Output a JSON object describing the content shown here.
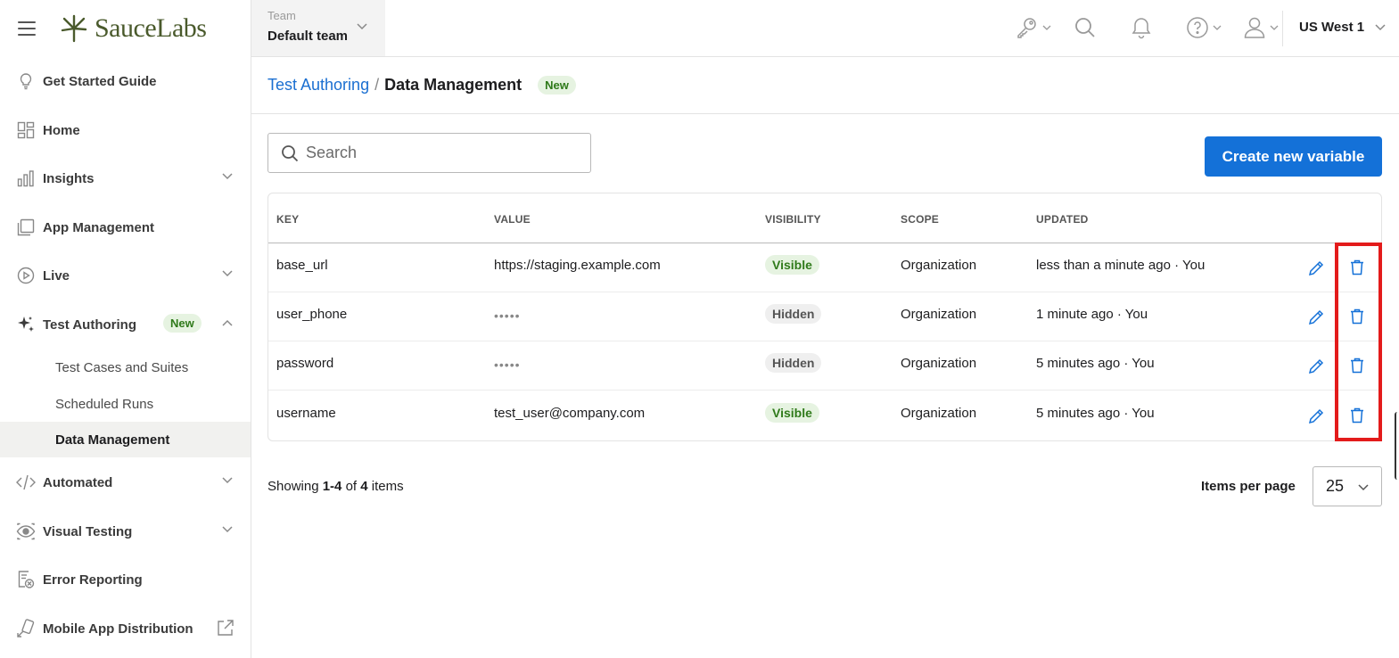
{
  "brand": {
    "name": "SauceLabs"
  },
  "topbar": {
    "team_label": "Team",
    "team_value": "Default team",
    "region": "US West 1"
  },
  "sidebar": {
    "items": [
      {
        "label": "Get Started Guide",
        "icon": "lightbulb-icon"
      },
      {
        "label": "Home",
        "icon": "dashboard-icon"
      },
      {
        "label": "Insights",
        "icon": "bar-chart-icon"
      },
      {
        "label": "App Management",
        "icon": "app-icon"
      },
      {
        "label": "Live",
        "icon": "play-icon"
      },
      {
        "label": "Test Authoring",
        "icon": "sparkle-icon",
        "badge": "New"
      },
      {
        "label": "Automated",
        "icon": "code-icon"
      },
      {
        "label": "Visual Testing",
        "icon": "eye-icon"
      },
      {
        "label": "Error Reporting",
        "icon": "error-report-icon"
      },
      {
        "label": "Mobile App Distribution",
        "icon": "mobile-distribution-icon"
      }
    ],
    "sub_items": [
      {
        "label": "Test Cases and Suites"
      },
      {
        "label": "Scheduled Runs"
      },
      {
        "label": "Data Management"
      }
    ]
  },
  "breadcrumb": {
    "parent": "Test Authoring",
    "separator": "/",
    "current": "Data Management",
    "badge": "New"
  },
  "search": {
    "placeholder": "Search"
  },
  "create_button": "Create new variable",
  "table": {
    "columns": [
      "KEY",
      "VALUE",
      "VISIBILITY",
      "SCOPE",
      "UPDATED"
    ],
    "rows": [
      {
        "key": "base_url",
        "value": "https://staging.example.com",
        "visibility": "Visible",
        "scope": "Organization",
        "updated": "less than a minute ago · You"
      },
      {
        "key": "user_phone",
        "value": "•••••",
        "visibility": "Hidden",
        "scope": "Organization",
        "updated": "1 minute ago · You"
      },
      {
        "key": "password",
        "value": "•••••",
        "visibility": "Hidden",
        "scope": "Organization",
        "updated": "5 minutes ago · You"
      },
      {
        "key": "username",
        "value": "test_user@company.com",
        "visibility": "Visible",
        "scope": "Organization",
        "updated": "5 minutes ago · You"
      }
    ]
  },
  "pagination": {
    "showing_prefix": "Showing",
    "range": "1-4",
    "of": "of",
    "total": "4",
    "items_suffix": "items",
    "per_page_label": "Items per page",
    "per_page_value": "25"
  },
  "colors": {
    "accent": "#1471d8",
    "brand": "#4a5a2c",
    "highlight": "#e31b1b",
    "success": "#2f7a1a"
  }
}
